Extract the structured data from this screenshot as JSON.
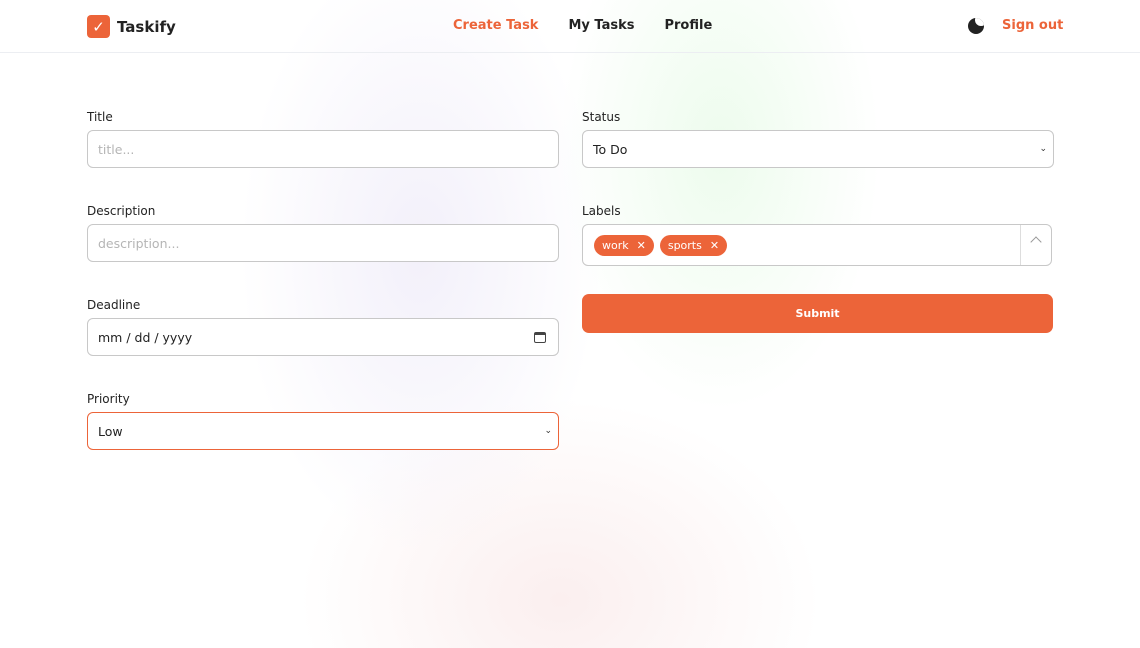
{
  "brand": {
    "name": "Taskify",
    "accent": "#ec6439"
  },
  "nav": {
    "items": [
      {
        "label": "Create Task",
        "active": true
      },
      {
        "label": "My Tasks"
      },
      {
        "label": "Profile"
      }
    ],
    "sign_out": "Sign out",
    "theme_icon": "moon-icon"
  },
  "form": {
    "title": {
      "label": "Title",
      "placeholder": "title..."
    },
    "description": {
      "label": "Description",
      "placeholder": "description..."
    },
    "deadline": {
      "label": "Deadline",
      "value": "mm / dd / yyyy"
    },
    "priority": {
      "label": "Priority",
      "value": "Low"
    },
    "status": {
      "label": "Status",
      "value": "To Do"
    },
    "labels": {
      "label": "Labels",
      "chips": [
        "work",
        "sports"
      ],
      "remove": "✕"
    },
    "submit": "Submit"
  }
}
